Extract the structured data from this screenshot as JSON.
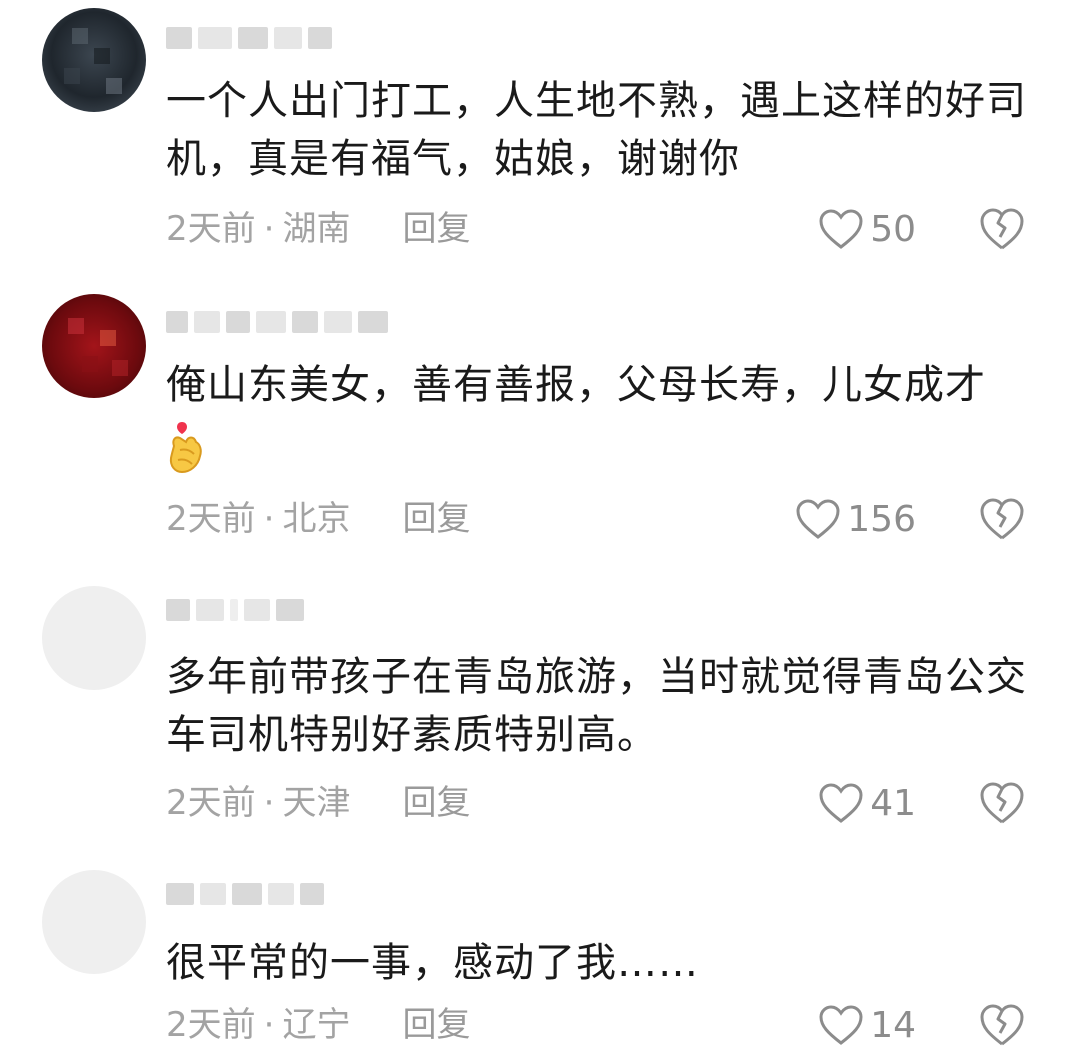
{
  "comments": [
    {
      "text": "一个人出门打工，人生地不熟，遇上这样的好司机，真是有福气，姑娘，谢谢你",
      "time": "2天前",
      "location": "湖南",
      "reply_label": "回复",
      "likes": "50"
    },
    {
      "text": "俺山东美女，善有善报，父母长寿，儿女成才",
      "time": "2天前",
      "location": "北京",
      "reply_label": "回复",
      "likes": "156"
    },
    {
      "text": "多年前带孩子在青岛旅游，当时就觉得青岛公交车司机特别好素质特别高。",
      "time": "2天前",
      "location": "天津",
      "reply_label": "回复",
      "likes": "41"
    },
    {
      "text": "很平常的一事，感动了我……",
      "time": "2天前",
      "location": "辽宁",
      "reply_label": "回复",
      "likes": "14"
    }
  ],
  "separator": "·",
  "icons": {
    "like": "heart-outline-icon",
    "dislike": "broken-heart-icon",
    "emoji": "finger-heart-emoji"
  },
  "colors": {
    "meta": "#a3a3a3",
    "text": "#1a1a1a",
    "icon": "#8c8c8c"
  }
}
